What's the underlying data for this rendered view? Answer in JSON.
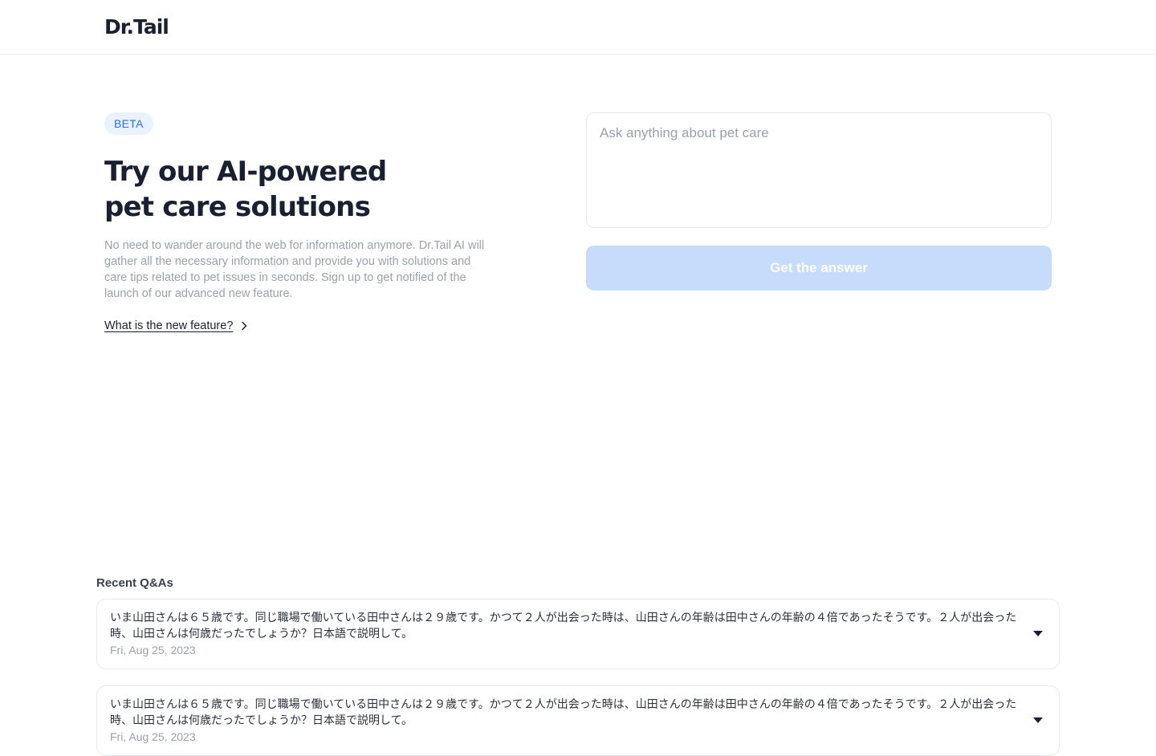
{
  "header": {
    "logo": "Dr.Tail"
  },
  "hero": {
    "badge": "BETA",
    "title_line1": "Try our AI-powered",
    "title_line2": "pet care solutions",
    "description": "No need to wander around the web for information anymore. Dr.Tail AI will gather all the necessary information and provide you with solutions and care tips related to pet issues in seconds. Sign up to get notified of the launch of our advanced new feature.",
    "link_text": "What is the new feature?"
  },
  "ask": {
    "placeholder": "Ask anything about pet care",
    "value": "",
    "button_label": "Get the answer"
  },
  "recent": {
    "title": "Recent Q&As",
    "items": [
      {
        "question": "いま山田さんは６５歳です。同じ職場で働いている田中さんは２９歳です。かつて２人が出会った時は、山田さんの年齢は田中さんの年齢の４倍であったそうです。２人が出会った時、山田さんは何歳だったでしょうか？日本語で説明して。",
        "date": "Fri, Aug 25, 2023"
      },
      {
        "question": "いま山田さんは６５歳です。同じ職場で働いている田中さんは２９歳です。かつて２人が出会った時は、山田さんの年齢は田中さんの年齢の４倍であったそうです。２人が出会った時、山田さんは何歳だったでしょうか？日本語で説明して。",
        "date": "Fri, Aug 25, 2023"
      }
    ]
  },
  "colors": {
    "accent": "#2f6fd8",
    "badge_bg": "#eaf2fd",
    "button_disabled": "#c7dbfb",
    "muted_text": "#9aa1ac"
  }
}
